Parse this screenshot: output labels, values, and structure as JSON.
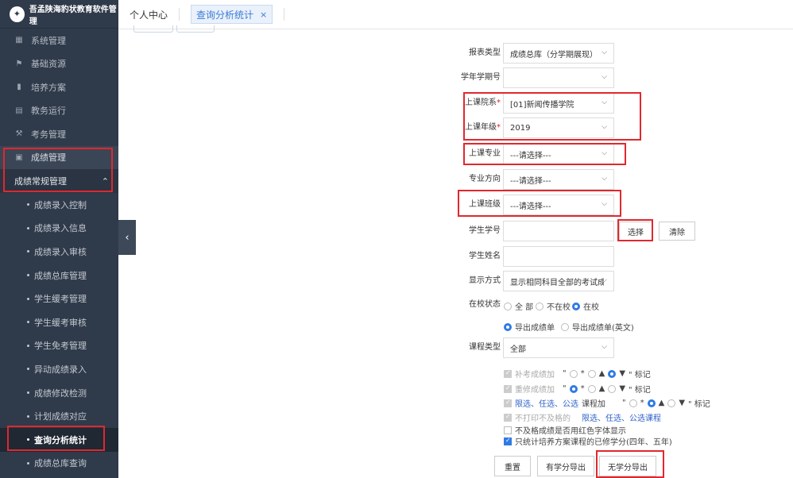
{
  "sidebar": {
    "logo_text": "吾孟陕海豹状教育软件管理",
    "menu": [
      {
        "label": "系统管理",
        "icon": "grid-icon"
      },
      {
        "label": "基础资源",
        "icon": "flag-icon"
      },
      {
        "label": "培养方案",
        "icon": "book-icon"
      },
      {
        "label": "教务运行",
        "icon": "calendar-icon"
      },
      {
        "label": "考务管理",
        "icon": "gavel-icon"
      },
      {
        "label": "成绩管理",
        "icon": "briefcase-icon"
      }
    ],
    "sub_header": "成绩常规管理",
    "sub_items": [
      "成绩录入控制",
      "成绩录入信息",
      "成绩录入审核",
      "成绩总库管理",
      "学生缓考管理",
      "学生缓考审核",
      "学生免考管理",
      "异动成绩录入",
      "成绩修改检测",
      "计划成绩对应",
      "查询分析统计",
      "成绩总库查询"
    ]
  },
  "tabs": {
    "home": "个人中心",
    "active": "查询分析统计",
    "close": "×"
  },
  "form": {
    "report_type": {
      "label": "报表类型",
      "value": "成绩总库（分学期展现）"
    },
    "term": {
      "label": "学年学期号",
      "value": ""
    },
    "dept": {
      "label": "上课院系",
      "req": "*",
      "value": "[01]新闻传播学院"
    },
    "grade": {
      "label": "上课年级",
      "req": "*",
      "value": "2019"
    },
    "major": {
      "label": "上课专业",
      "value": "---请选择---"
    },
    "direction": {
      "label": "专业方向",
      "value": "---请选择---"
    },
    "class": {
      "label": "上课班级",
      "value": "---请选择---"
    },
    "student_no": {
      "label": "学生学号",
      "value": "",
      "select_btn": "选择",
      "clear_btn": "清除"
    },
    "student_name": {
      "label": "学生姓名",
      "value": ""
    },
    "display_mode": {
      "label": "显示方式",
      "value": "显示相同科目全部的考试成绩"
    },
    "status": {
      "label": "在校状态",
      "options": [
        "全 部",
        "不在校",
        "在校"
      ]
    },
    "export": {
      "options": [
        "导出成绩单",
        "导出成绩单(英文)"
      ]
    },
    "course_type": {
      "label": "课程类型",
      "value": "全部"
    },
    "rules": {
      "makeup": "补考成绩加",
      "retake": "重修成绩加",
      "elective_prefix": "限选、任选、公选",
      "elective_suffix": "课程加",
      "quote_open": "\"",
      "star": "*",
      "tri": "▲",
      "tri_down": "▼",
      "quote_mark": "\" 标记",
      "no_print_prefix": "不打印不及格的",
      "no_print_suffix": "限选、任选、公选课程",
      "red_font": "不及格成绩是否用红色字体显示",
      "only_plan": "只统计培养方案课程的已修学分(四年、五年)"
    },
    "buttons": {
      "reset": "重置",
      "with_credit": "有学分导出",
      "no_credit": "无学分导出"
    }
  },
  "colors": {
    "sidebar_bg": "#2f3a4a",
    "accent": "#2f7ae5",
    "highlight": "#e0282e"
  }
}
